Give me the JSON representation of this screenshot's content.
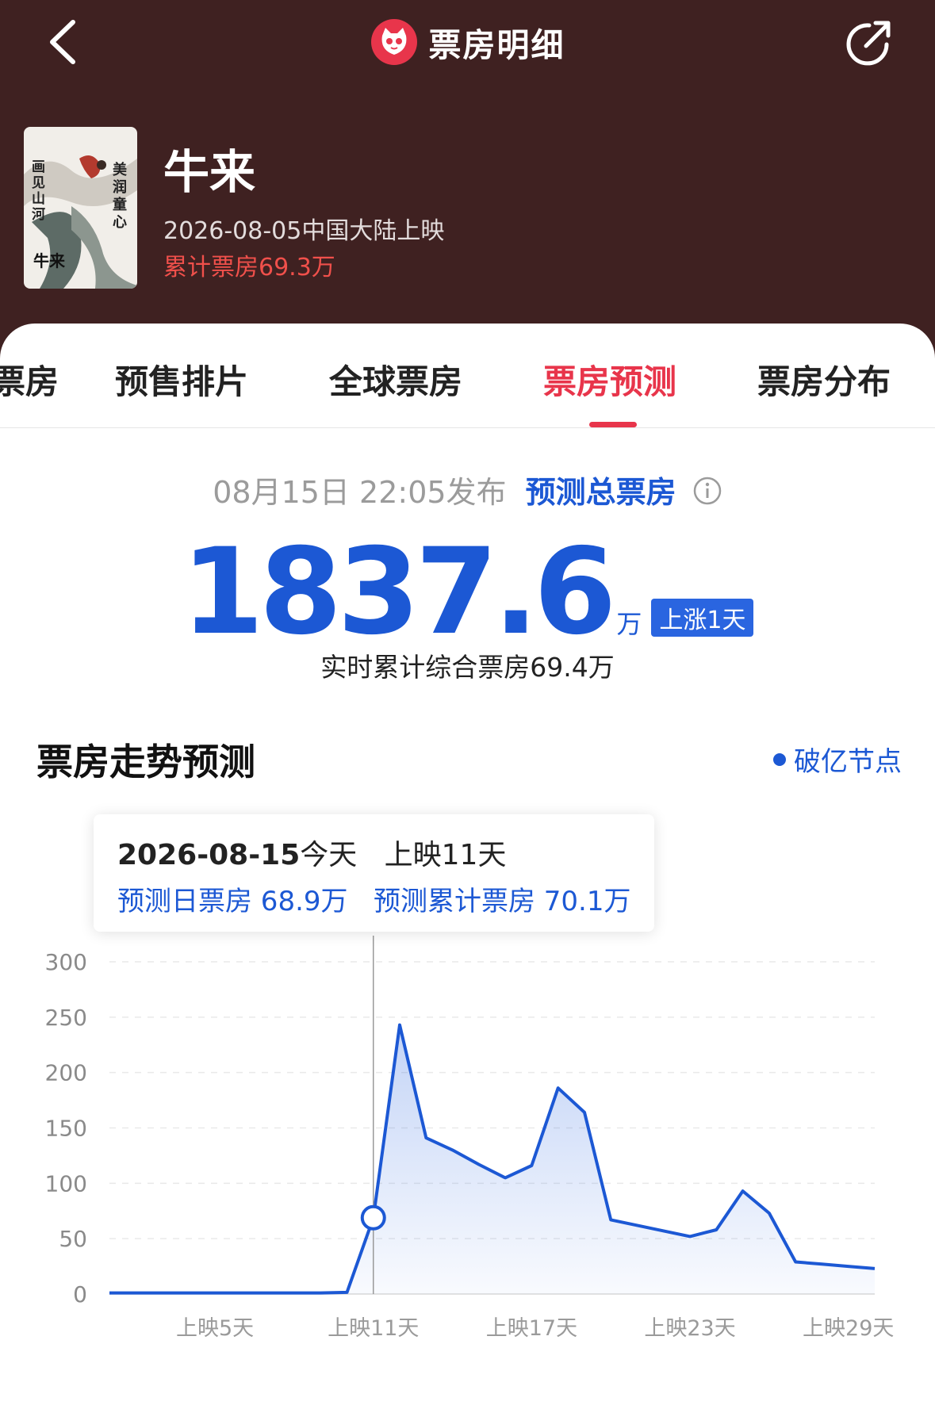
{
  "header": {
    "title": "票房明细",
    "back_icon": "chevron-left-icon",
    "share_icon": "share-icon",
    "logo_icon": "cat-logo-icon"
  },
  "movie": {
    "name": "牛来",
    "release": "2026-08-05中国大陆上映",
    "total_box": "累计票房69.3万",
    "poster_texts": [
      "美润童心",
      "画见山河",
      "牛来"
    ]
  },
  "tabs": [
    {
      "label": "票房"
    },
    {
      "label": "预售排片"
    },
    {
      "label": "全球票房"
    },
    {
      "label": "票房预测"
    },
    {
      "label": "票房分布"
    }
  ],
  "forecast": {
    "publish_time": "08月15日 22:05发布",
    "title": "预测总票房",
    "value": "1837.6",
    "unit": "万",
    "badge": "上涨1天",
    "realtime": "实时累计综合票房69.4万"
  },
  "trend": {
    "title": "票房走势预测",
    "legend": "破亿节点"
  },
  "tooltip": {
    "date": "2026-08-15",
    "today": "今天",
    "day": "上映11天",
    "daily": "预测日票房 68.9万",
    "cumulative": "预测累计票房 70.1万"
  },
  "colors": {
    "header_bg": "#3f2121",
    "accent_red": "#e8354b",
    "primary_blue": "#1c58d4"
  },
  "chart_data": {
    "type": "area",
    "x_tick_labels": [
      "上映5天",
      "上映11天",
      "上映17天",
      "上映23天",
      "上映29天"
    ],
    "x_tick_days": [
      5,
      11,
      17,
      23,
      29
    ],
    "y_ticks": [
      0,
      50,
      100,
      150,
      200,
      250,
      300
    ],
    "ylim": [
      0,
      300
    ],
    "xlim": [
      1,
      30
    ],
    "grid": true,
    "highlight_day": 11,
    "series": [
      {
        "x": [
          1,
          2,
          3,
          4,
          5,
          6,
          7,
          8,
          9,
          10,
          11,
          12,
          13,
          14,
          15,
          16,
          17,
          18,
          19,
          20,
          21,
          22,
          23,
          24,
          25,
          26,
          27,
          28,
          29,
          30
        ],
        "values": [
          1,
          1,
          1,
          1,
          1,
          1,
          1,
          1,
          1,
          1.5,
          68.9,
          243,
          141,
          130,
          117,
          105,
          116,
          186,
          164,
          67,
          62,
          57,
          52,
          58,
          93,
          73,
          29,
          27,
          25,
          23
        ]
      }
    ]
  }
}
